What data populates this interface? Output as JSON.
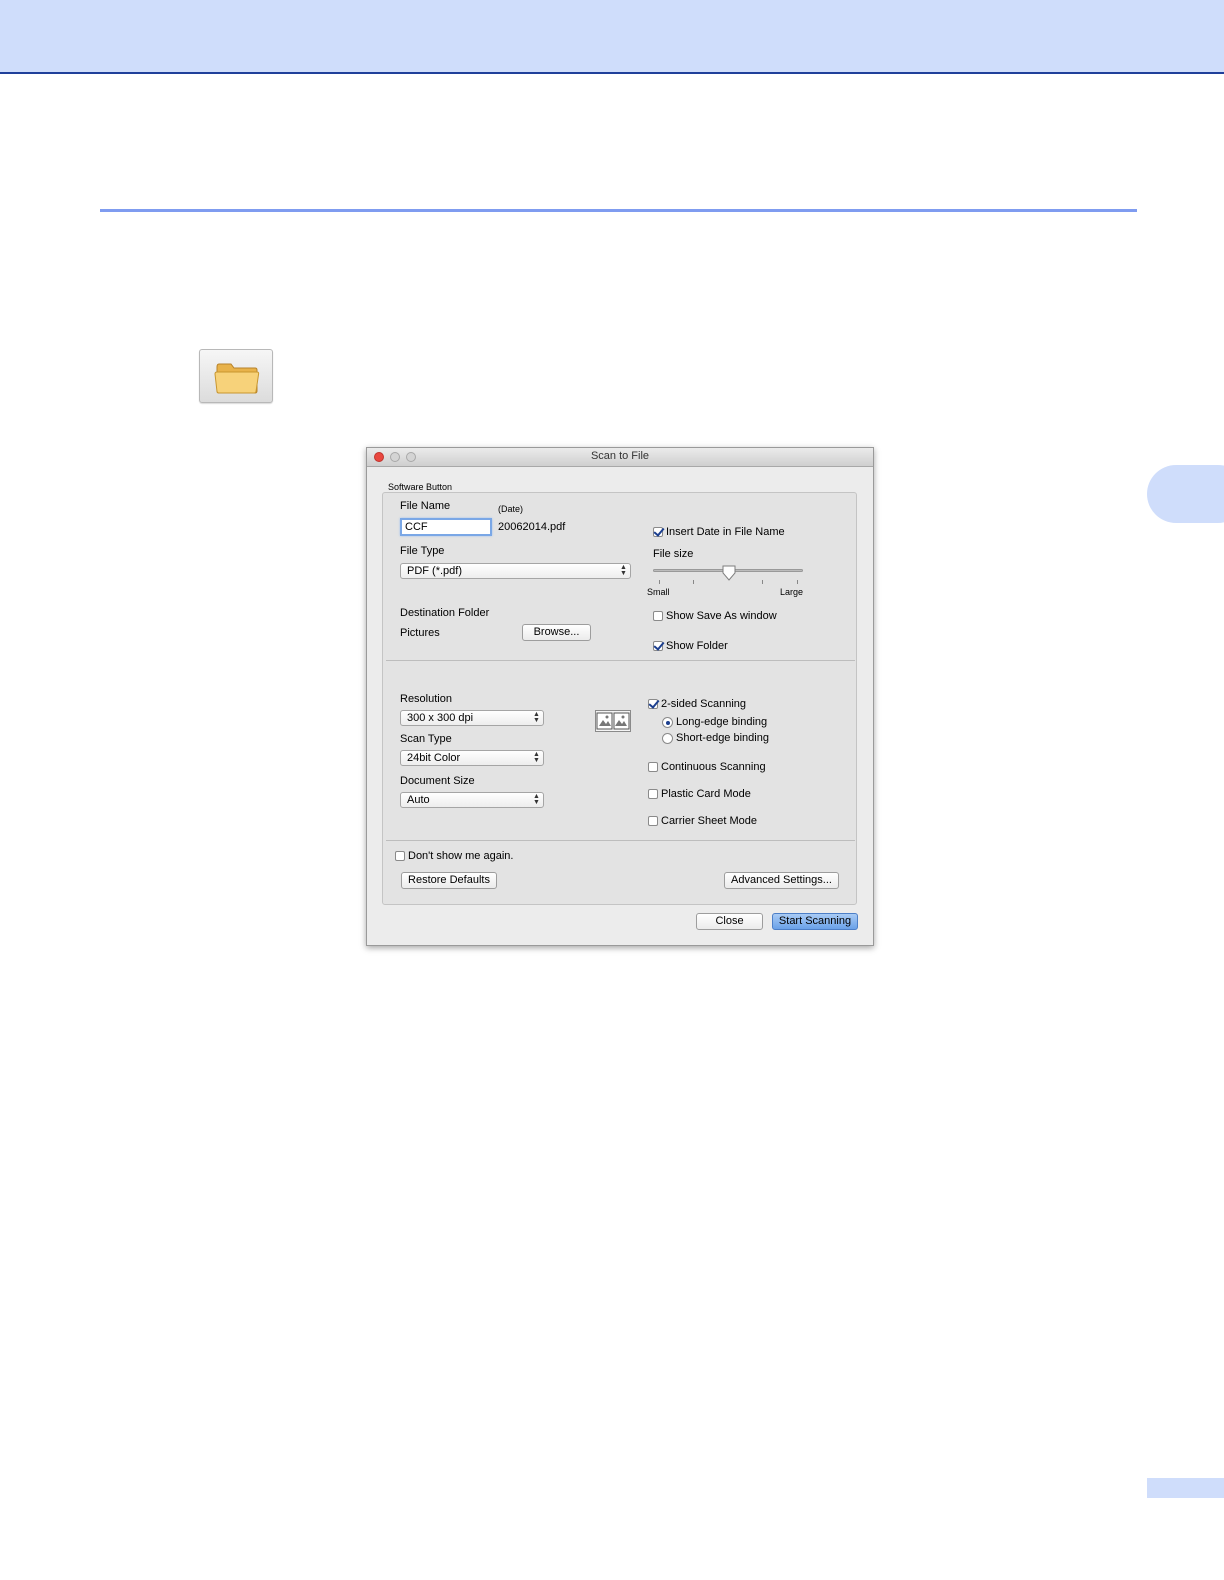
{
  "dialog": {
    "title": "Scan to File",
    "group_label": "Software Button",
    "file_name_label": "File Name",
    "date_label": "(Date)",
    "file_name_value": "CCF",
    "file_name_suffix": "20062014.pdf",
    "insert_date_label": "Insert Date in File Name",
    "insert_date_checked": true,
    "file_type_label": "File Type",
    "file_type_value": "PDF (*.pdf)",
    "file_size_label": "File size",
    "file_size_small": "Small",
    "file_size_large": "Large",
    "destination_label": "Destination Folder",
    "destination_value": "Pictures",
    "browse_label": "Browse...",
    "show_save_as_label": "Show Save As window",
    "show_save_as_checked": false,
    "show_folder_label": "Show Folder",
    "show_folder_checked": true,
    "resolution_label": "Resolution",
    "resolution_value": "300 x 300 dpi",
    "scan_type_label": "Scan Type",
    "scan_type_value": "24bit Color",
    "document_size_label": "Document Size",
    "document_size_value": "Auto",
    "two_sided_label": "2-sided Scanning",
    "two_sided_checked": true,
    "long_edge_label": "Long-edge binding",
    "short_edge_label": "Short-edge binding",
    "binding_selected": "Long-edge binding",
    "continuous_label": "Continuous Scanning",
    "plastic_card_label": "Plastic Card Mode",
    "carrier_sheet_label": "Carrier Sheet Mode",
    "dont_show_label": "Don't show me again.",
    "restore_defaults_label": "Restore Defaults",
    "advanced_settings_label": "Advanced Settings...",
    "close_label": "Close",
    "start_scanning_label": "Start Scanning"
  },
  "icons": {
    "toolbar_button": "folder-icon"
  },
  "colors": {
    "header_band": "#cfddfb",
    "section_rule": "#7f9cf0",
    "primary_button": "#6aa1e8"
  }
}
